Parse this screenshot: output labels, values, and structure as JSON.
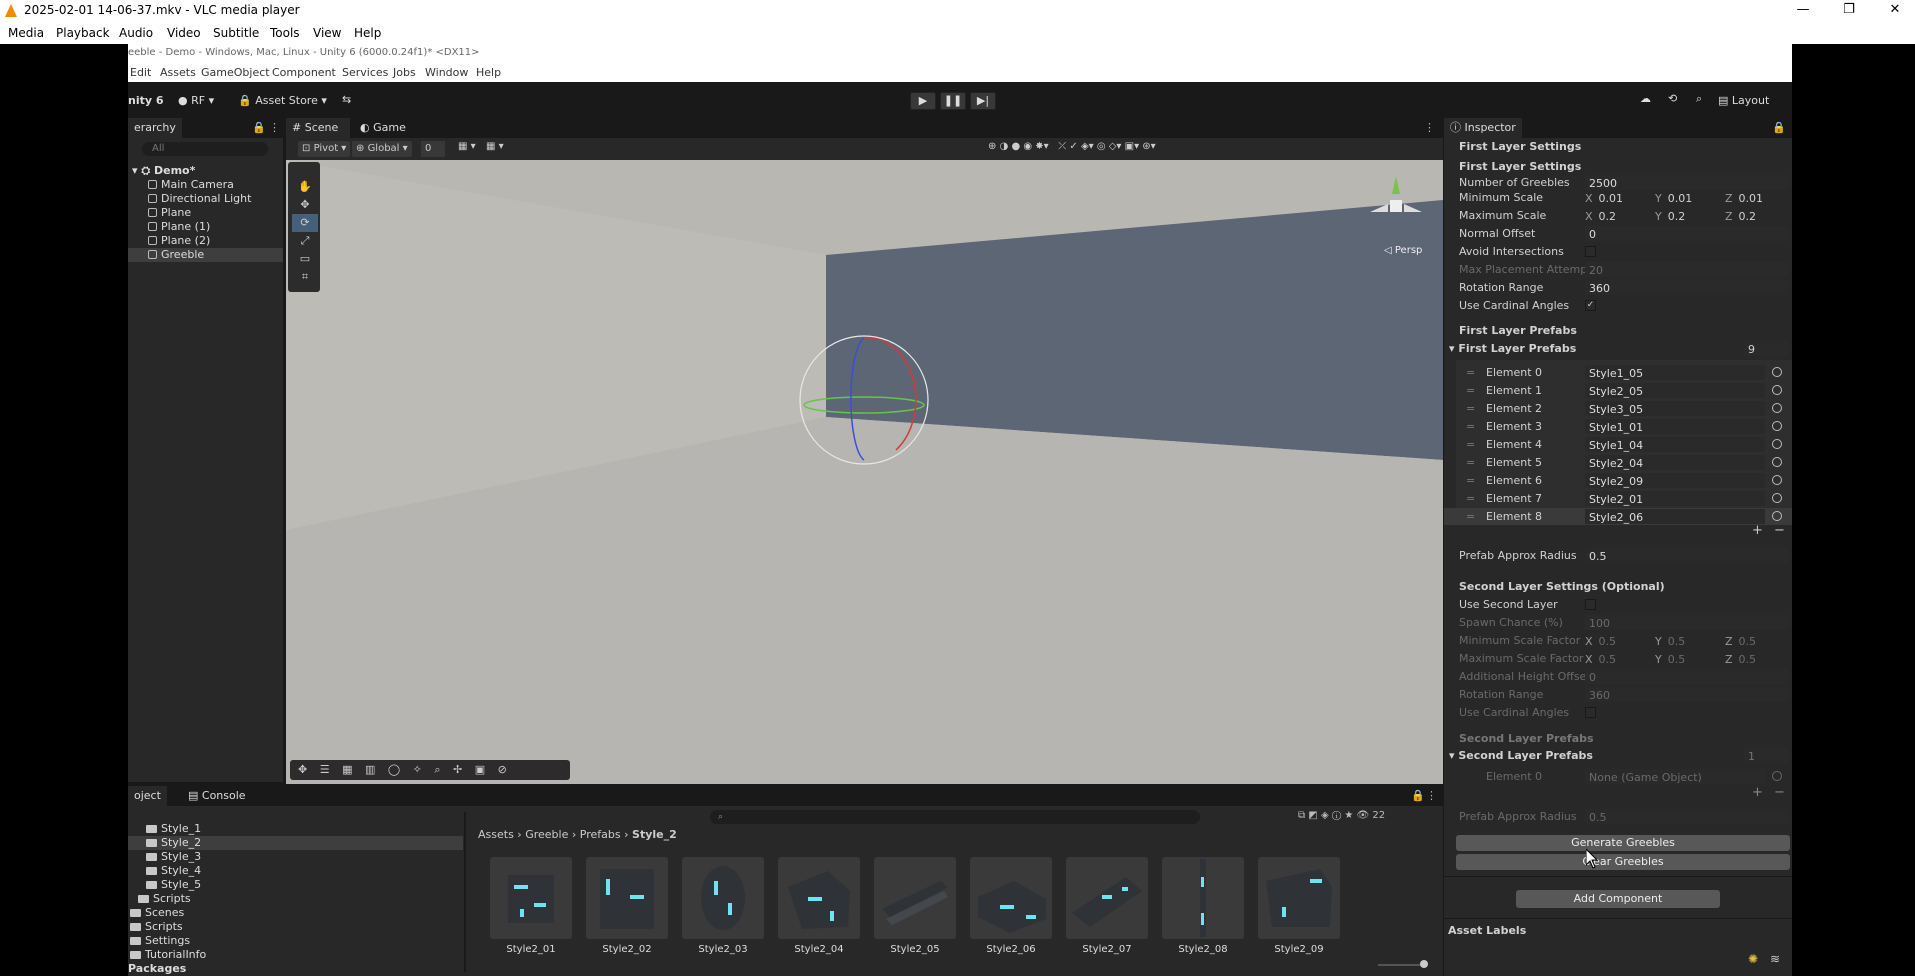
{
  "vlc": {
    "title": "2025-02-01 14-06-37.mkv - VLC media player",
    "menu": [
      "Media",
      "Playback",
      "Audio",
      "Video",
      "Subtitle",
      "Tools",
      "View",
      "Help"
    ],
    "window_controls": [
      "—",
      "❐",
      "✕"
    ]
  },
  "unity": {
    "title": "eeble - Demo - Windows, Mac, Linux - Unity 6 (6000.0.24f1)* <DX11>",
    "menu": [
      "Edit",
      "Assets",
      "GameObject",
      "Component",
      "Services",
      "Jobs",
      "Window",
      "Help"
    ],
    "toolbar": {
      "version": "nity 6",
      "account": "RF",
      "asset_store": "Asset Store",
      "layout": "Layout"
    },
    "hierarchy": {
      "tab": "erarchy",
      "search_placeholder": "All",
      "scene": "Demo*",
      "items": [
        "Main Camera",
        "Directional Light",
        "Plane",
        "Plane (1)",
        "Plane (2)",
        "Greeble"
      ],
      "selected": "Greeble"
    },
    "scene": {
      "tabs": [
        "Scene",
        "Game"
      ],
      "pivot": "Pivot",
      "global": "Global",
      "snap_value": "0",
      "persp_label": "Persp"
    },
    "project": {
      "tabs": [
        "oject",
        "Console"
      ],
      "tree": [
        {
          "label": "Style_1",
          "level": 2
        },
        {
          "label": "Style_2",
          "level": 2,
          "selected": true
        },
        {
          "label": "Style_3",
          "level": 2
        },
        {
          "label": "Style_4",
          "level": 2
        },
        {
          "label": "Style_5",
          "level": 2
        },
        {
          "label": "Scripts",
          "level": 1
        },
        {
          "label": "Scenes",
          "level": 0
        },
        {
          "label": "Scripts",
          "level": 0
        },
        {
          "label": "Settings",
          "level": 0
        },
        {
          "label": "TutorialInfo",
          "level": 0
        },
        {
          "label": "Packages",
          "level": -1
        }
      ],
      "breadcrumb": [
        "Assets",
        "Greeble",
        "Prefabs",
        "Style_2"
      ],
      "count": "22",
      "assets": [
        "Style2_01",
        "Style2_02",
        "Style2_03",
        "Style2_04",
        "Style2_05",
        "Style2_06",
        "Style2_07",
        "Style2_08",
        "Style2_09"
      ]
    },
    "inspector": {
      "tab": "Inspector",
      "section_top": "First Layer Settings",
      "first_layer_header": "First Layer Settings",
      "number_of_greebles": {
        "label": "Number of Greebles",
        "value": "2500"
      },
      "minimum_scale": {
        "label": "Minimum Scale",
        "x": "0.01",
        "y": "0.01",
        "z": "0.01"
      },
      "maximum_scale": {
        "label": "Maximum Scale",
        "x": "0.2",
        "y": "0.2",
        "z": "0.2"
      },
      "normal_offset": {
        "label": "Normal Offset",
        "value": "0"
      },
      "avoid_intersections": {
        "label": "Avoid Intersections"
      },
      "max_placement_attempts": {
        "label": "Max Placement Attempts",
        "value": "20"
      },
      "rotation_range": {
        "label": "Rotation Range",
        "value": "360"
      },
      "use_cardinal_angles": {
        "label": "Use Cardinal Angles",
        "check": "✓"
      },
      "first_layer_prefabs_header": "First Layer Prefabs",
      "first_layer_prefabs_fold": "First Layer Prefabs",
      "prefab_count": "9",
      "elements": [
        {
          "label": "Element 0",
          "value": "Style1_05"
        },
        {
          "label": "Element 1",
          "value": "Style2_05"
        },
        {
          "label": "Element 2",
          "value": "Style3_05"
        },
        {
          "label": "Element 3",
          "value": "Style1_01"
        },
        {
          "label": "Element 4",
          "value": "Style1_04"
        },
        {
          "label": "Element 5",
          "value": "Style2_04"
        },
        {
          "label": "Element 6",
          "value": "Style2_09"
        },
        {
          "label": "Element 7",
          "value": "Style2_01"
        },
        {
          "label": "Element 8",
          "value": "Style2_06"
        }
      ],
      "prefab_approx_radius": {
        "label": "Prefab Approx Radius",
        "value": "0.5"
      },
      "second_layer_header": "Second Layer Settings (Optional)",
      "use_second_layer": {
        "label": "Use Second Layer"
      },
      "spawn_chance": {
        "label": "Spawn Chance (%)",
        "value": "100"
      },
      "min_scale_factor": {
        "label": "Minimum Scale Factor",
        "x": "0.5",
        "y": "0.5",
        "z": "0.5"
      },
      "max_scale_factor": {
        "label": "Maximum Scale Factor",
        "x": "0.5",
        "y": "0.5",
        "z": "0.5"
      },
      "additional_height_offset": {
        "label": "Additional Height Offset",
        "value": "0"
      },
      "rotation_range2": {
        "label": "Rotation Range",
        "value": "360"
      },
      "use_cardinal_angles2": {
        "label": "Use Cardinal Angles"
      },
      "second_layer_prefabs_header": "Second Layer Prefabs",
      "second_layer_prefabs_fold": "Second Layer Prefabs",
      "second_prefab_count": "1",
      "second_element": {
        "label": "Element 0",
        "value": "None (Game Object)"
      },
      "prefab_approx_radius2": {
        "label": "Prefab Approx Radius",
        "value": "0.5"
      },
      "generate_button": "Generate Greebles",
      "clear_button": "Clear Greebles",
      "add_component_button": "Add Component",
      "asset_labels": "Asset Labels",
      "axis": {
        "x": "X",
        "y": "Y",
        "z": "Z"
      },
      "plus": "+",
      "minus": "−"
    }
  }
}
